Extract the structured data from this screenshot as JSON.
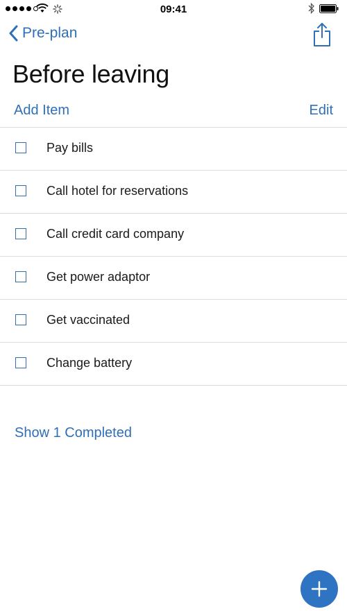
{
  "status_bar": {
    "time": "09:41",
    "signal_icon": "signal-dots-icon",
    "wifi_icon": "wifi-icon",
    "activity_icon": "activity-spinner-icon",
    "bluetooth_icon": "bluetooth-icon",
    "battery_icon": "battery-icon"
  },
  "nav": {
    "back_label": "Pre-plan",
    "back_icon": "chevron-left-icon",
    "share_icon": "share-icon"
  },
  "title": "Before leaving",
  "toolbar": {
    "add_item_label": "Add Item",
    "edit_label": "Edit"
  },
  "tasks": [
    {
      "label": "Pay bills",
      "checked": false
    },
    {
      "label": "Call hotel for reservations",
      "checked": false
    },
    {
      "label": "Call credit card company",
      "checked": false
    },
    {
      "label": "Get power adaptor",
      "checked": false
    },
    {
      "label": "Get vaccinated",
      "checked": false
    },
    {
      "label": "Change battery",
      "checked": false
    }
  ],
  "show_completed_label": "Show 1 Completed",
  "fab_icon": "plus-icon",
  "colors": {
    "accent": "#2e6fb8",
    "fab": "#2f74c2",
    "divider": "#dcdcdc",
    "text": "#1a1a1a"
  }
}
